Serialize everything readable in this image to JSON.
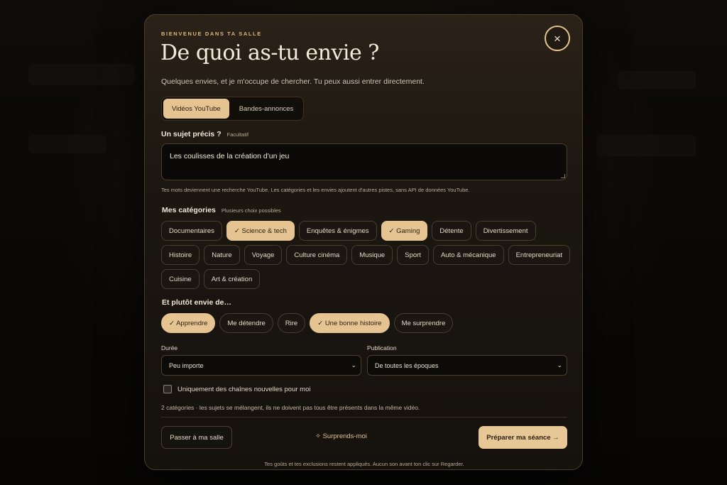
{
  "modal": {
    "eyebrow": "BIENVENUE DANS TA SALLE",
    "title": "De quoi as-tu envie ?",
    "subtitle": "Quelques envies, et je m'occupe de chercher. Tu peux aussi entrer directement.",
    "close_icon": "×"
  },
  "tabs": [
    {
      "label": "Vidéos YouTube",
      "active": true
    },
    {
      "label": "Bandes-annonces",
      "active": false
    }
  ],
  "topic": {
    "label": "Un sujet précis ?",
    "hint": "Facultatif",
    "value": "Les coulisses de la création d'un jeu",
    "help": "Tes mots deviennent une recherche YouTube. Les catégories et les envies ajoutent d'autres pistes, sans API de données YouTube."
  },
  "categories": {
    "label": "Mes catégories",
    "hint": "Plusieurs choix possibles",
    "items": [
      {
        "label": "Documentaires",
        "selected": false
      },
      {
        "label": "✓ Science & tech",
        "selected": true
      },
      {
        "label": "Enquêtes & énigmes",
        "selected": false
      },
      {
        "label": "✓ Gaming",
        "selected": true
      },
      {
        "label": "Détente",
        "selected": false
      },
      {
        "label": "Divertissement",
        "selected": false
      },
      {
        "label": "Histoire",
        "selected": false
      },
      {
        "label": "Nature",
        "selected": false
      },
      {
        "label": "Voyage",
        "selected": false
      },
      {
        "label": "Culture cinéma",
        "selected": false
      },
      {
        "label": "Musique",
        "selected": false
      },
      {
        "label": "Sport",
        "selected": false
      },
      {
        "label": "Auto & mécanique",
        "selected": false
      },
      {
        "label": "Entrepreneuriat",
        "selected": false
      },
      {
        "label": "Cuisine",
        "selected": false
      },
      {
        "label": "Art & création",
        "selected": false
      }
    ]
  },
  "moods": {
    "label": "Et plutôt envie de…",
    "items": [
      {
        "label": "✓ Apprendre",
        "selected": true
      },
      {
        "label": "Me détendre",
        "selected": false
      },
      {
        "label": "Rire",
        "selected": false
      },
      {
        "label": "✓ Une bonne histoire",
        "selected": true
      },
      {
        "label": "Me surprendre",
        "selected": false
      }
    ]
  },
  "filters": {
    "duration_label": "Durée",
    "duration_value": "Peu importe",
    "publication_label": "Publication",
    "publication_value": "De toutes les époques"
  },
  "new_channels": {
    "label": "Uniquement des chaînes nouvelles pour moi",
    "checked": false
  },
  "summary": "2 catégories · les sujets se mélangent, ils ne doivent pas tous être présents dans la même vidéo.",
  "actions": {
    "skip": "Passer à ma salle",
    "surprise": "✧ Surprends-moi",
    "primary": "Préparer ma séance →"
  },
  "footnote": "Tes goûts et tes exclusions restent appliqués. Aucun son avant ton clic sur Regarder.",
  "colors": {
    "accent": "#e5c491",
    "background": "#15110d",
    "border": "#4b3e2d"
  }
}
